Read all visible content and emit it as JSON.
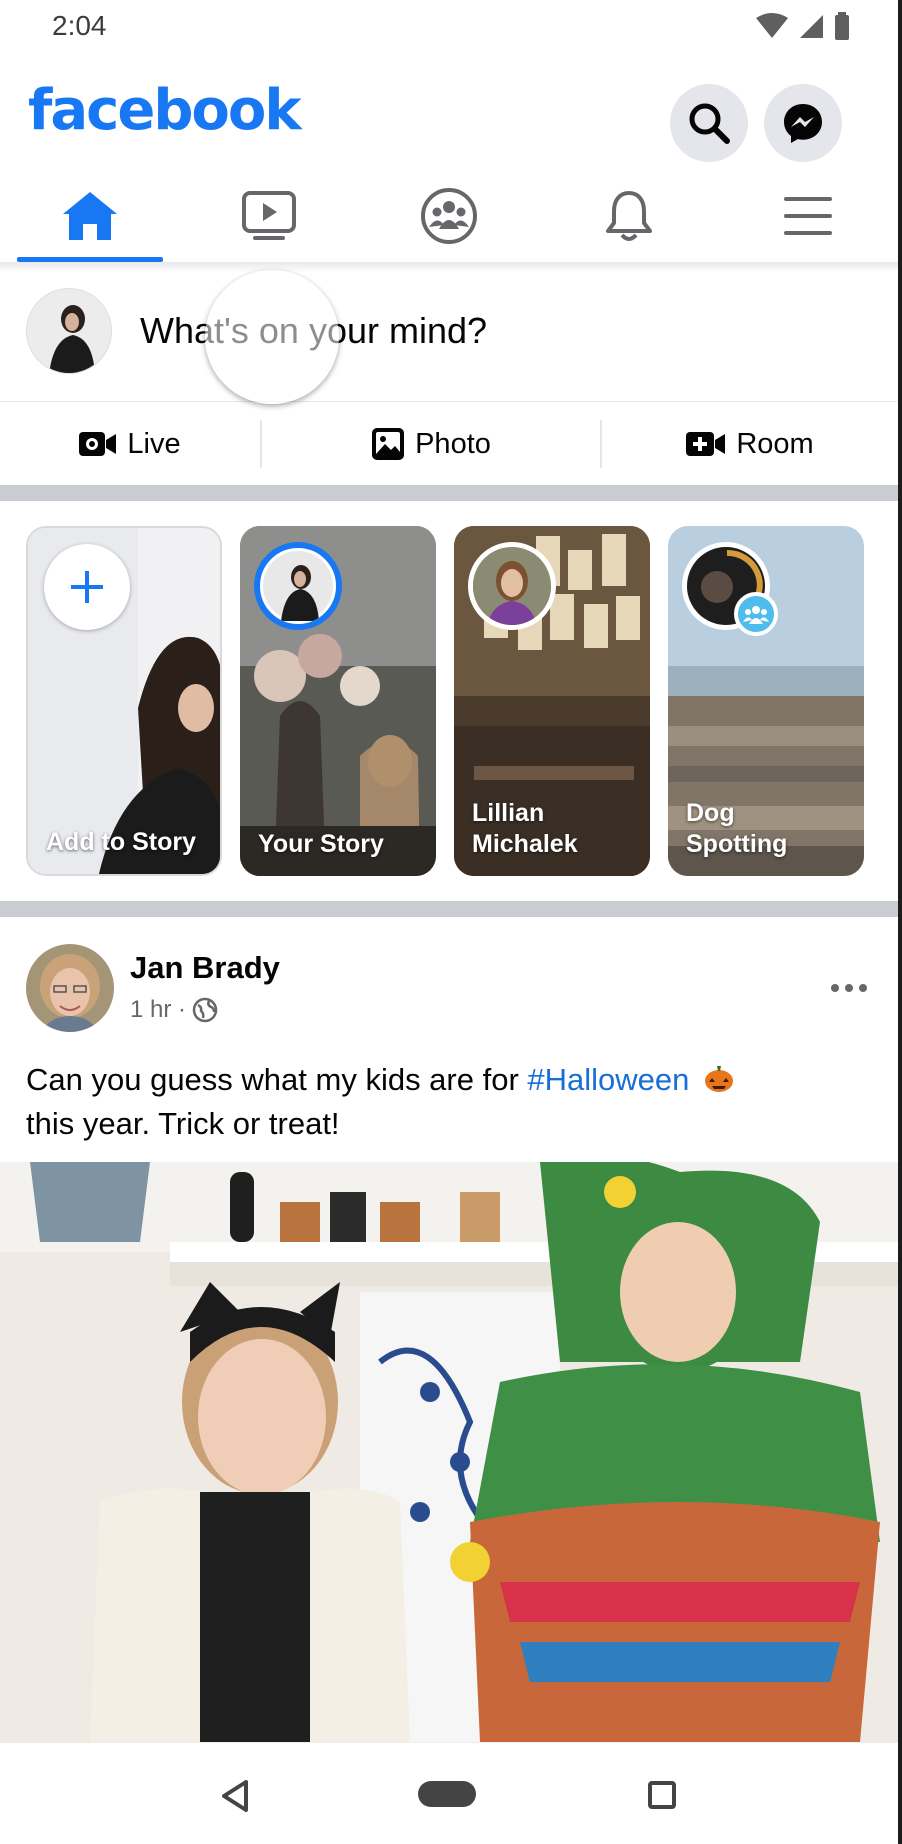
{
  "status_bar": {
    "time": "2:04"
  },
  "header": {
    "logo": "facebook",
    "search_icon": "search-icon",
    "messenger_icon": "messenger-icon"
  },
  "tabs": [
    {
      "name": "home",
      "icon": "home-icon",
      "active": true
    },
    {
      "name": "watch",
      "icon": "video-icon",
      "active": false
    },
    {
      "name": "groups",
      "icon": "groups-icon",
      "active": false
    },
    {
      "name": "notifications",
      "icon": "bell-icon",
      "active": false
    },
    {
      "name": "menu",
      "icon": "hamburger-menu-icon",
      "active": false
    }
  ],
  "composer": {
    "placeholder": "What's on your mind?"
  },
  "actions": [
    {
      "label": "Live",
      "icon": "live-video-icon"
    },
    {
      "label": "Photo",
      "icon": "photo-icon"
    },
    {
      "label": "Room",
      "icon": "room-icon"
    }
  ],
  "stories": [
    {
      "label": "Add to Story"
    },
    {
      "label": "Your Story"
    },
    {
      "label": "Lillian Michalek"
    },
    {
      "label": "Dog Spotting"
    }
  ],
  "post": {
    "author": "Jan Brady",
    "time": "1 hr ·",
    "text_before": "Can you guess what my kids are for ",
    "hashtag": "#Halloween",
    "text_after": "this year. Trick or treat!"
  },
  "colors": {
    "brand": "#1877f2",
    "link": "#1a6ed8",
    "separator": "#c9ccd1"
  }
}
